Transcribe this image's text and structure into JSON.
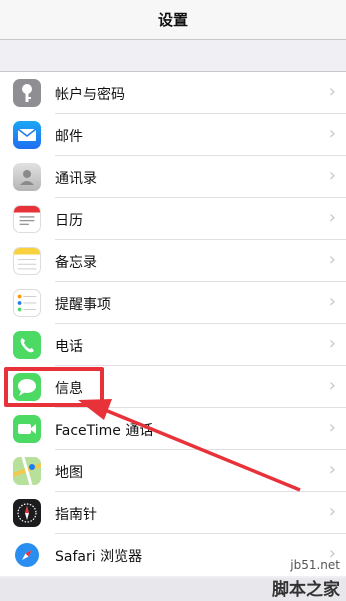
{
  "navbar": {
    "title": "设置"
  },
  "rows": [
    {
      "label": "帐户与密码",
      "icon": "key-icon",
      "color": "#8e8e93"
    },
    {
      "label": "邮件",
      "icon": "mail-icon",
      "color": "#1e8bf0"
    },
    {
      "label": "通讯录",
      "icon": "contacts-icon",
      "color": "#c8c8c8"
    },
    {
      "label": "日历",
      "icon": "calendar-icon",
      "color": "#ffffff"
    },
    {
      "label": "备忘录",
      "icon": "notes-icon",
      "color": "#ffffff"
    },
    {
      "label": "提醒事项",
      "icon": "reminders-icon",
      "color": "#ffffff"
    },
    {
      "label": "电话",
      "icon": "phone-icon",
      "color": "#4cd964"
    },
    {
      "label": "信息",
      "icon": "messages-icon",
      "color": "#4cd964"
    },
    {
      "label": "FaceTime 通话",
      "icon": "facetime-icon",
      "color": "#4cd964"
    },
    {
      "label": "地图",
      "icon": "maps-icon",
      "color": "#e8e8e8"
    },
    {
      "label": "指南针",
      "icon": "compass-icon",
      "color": "#1c1c1e"
    },
    {
      "label": "Safari 浏览器",
      "icon": "safari-icon",
      "color": "#ffffff"
    }
  ],
  "chevron": "›",
  "watermark": {
    "url": "jb51.net",
    "name": "脚本之家"
  },
  "accent": "#e8323a"
}
